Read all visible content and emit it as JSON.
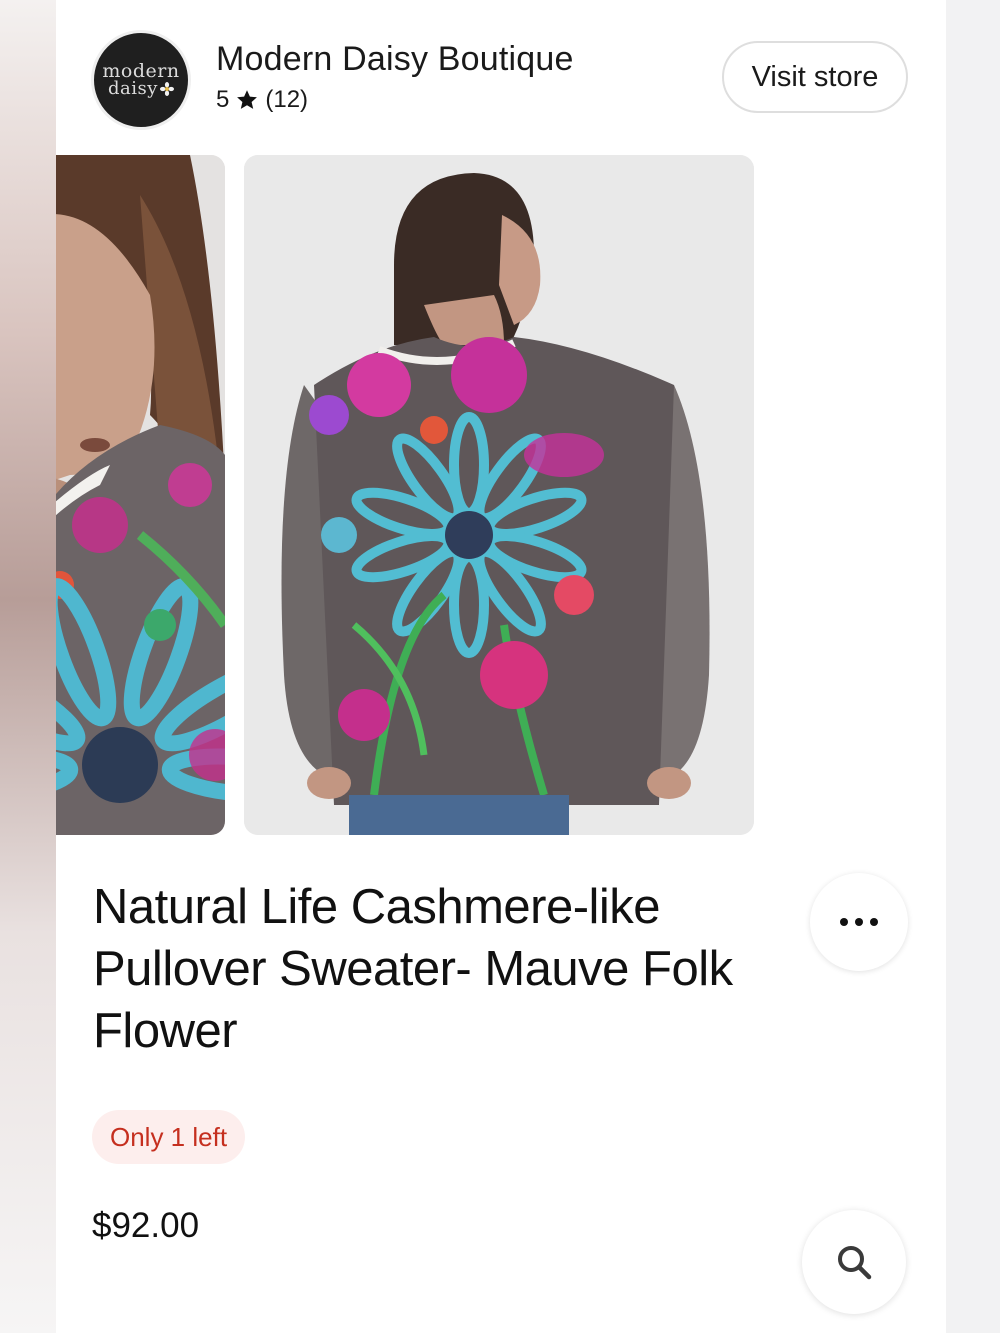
{
  "store": {
    "logo_line1": "modern",
    "logo_line2": "daisy",
    "name": "Modern Daisy Boutique",
    "rating": "5",
    "review_count": "(12)",
    "visit_label": "Visit store"
  },
  "gallery": {
    "images": [
      "sweater-front-closeup",
      "sweater-back-view"
    ]
  },
  "product": {
    "title": "Natural Life Cashmere-like Pullover Sweater- Mauve Folk Flower",
    "stock_badge": "Only 1 left",
    "price": "$92.00"
  },
  "icons": {
    "rating": "star-icon",
    "more": "more-options-icon",
    "search": "search-icon"
  },
  "colors": {
    "stock_text": "#c52f1f",
    "stock_bg": "#fdeeed"
  }
}
